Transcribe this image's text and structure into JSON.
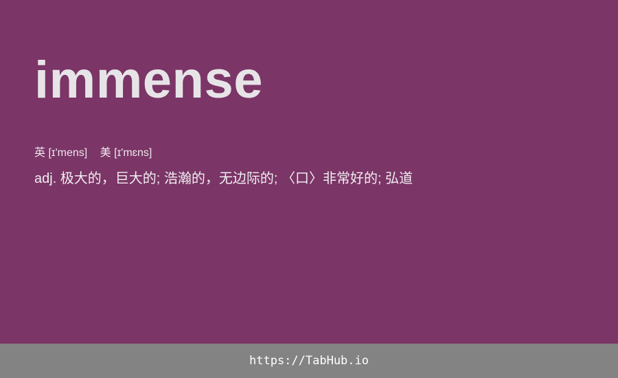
{
  "entry": {
    "word": "immense",
    "phonetic_uk": "英 [ɪ'mens]",
    "phonetic_us": "美 [ɪ'mɛns]",
    "definition": "adj. 极大的，巨大的; 浩瀚的，无边际的; 〈口〉非常好的; 弘道"
  },
  "footer": {
    "link_text": "https://TabHub.io"
  },
  "colors": {
    "background": "#7b3566",
    "footer_background": "#838383",
    "word_text": "#e7e4e8"
  }
}
